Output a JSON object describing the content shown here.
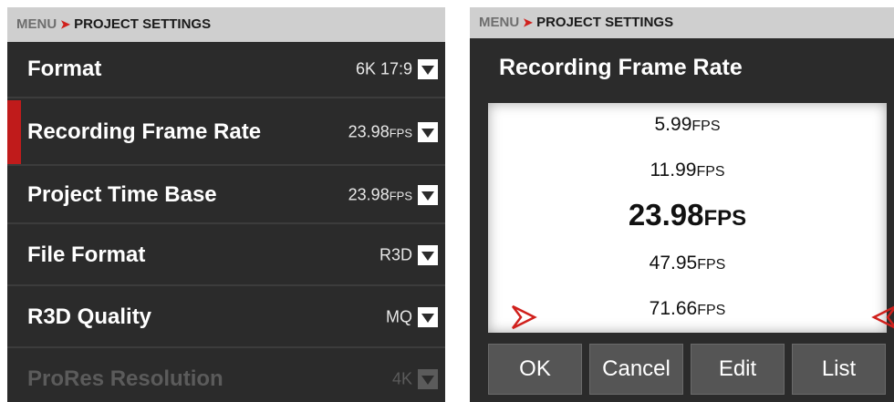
{
  "left": {
    "breadcrumb": {
      "root": "MENU",
      "arrow": "➤",
      "current": "PROJECT SETTINGS"
    },
    "rows": [
      {
        "label": "Format",
        "value": "6K 17:9",
        "unit": ""
      },
      {
        "label": "Recording Frame Rate",
        "value": "23.98",
        "unit": "FPS"
      },
      {
        "label": "Project Time Base",
        "value": "23.98",
        "unit": "FPS"
      },
      {
        "label": "File Format",
        "value": "R3D",
        "unit": ""
      },
      {
        "label": "R3D Quality",
        "value": "MQ",
        "unit": ""
      },
      {
        "label": "ProRes Resolution",
        "value": "4K",
        "unit": ""
      }
    ],
    "selected_row": "Recording Frame Rate",
    "disabled_row": "ProRes Resolution"
  },
  "right": {
    "breadcrumb": {
      "root": "MENU",
      "arrow": "➤",
      "current": "PROJECT SETTINGS"
    },
    "title": "Recording Frame Rate",
    "options": [
      {
        "value": "5.99",
        "unit": "FPS"
      },
      {
        "value": "11.99",
        "unit": "FPS"
      },
      {
        "value": "23.98",
        "unit": "FPS"
      },
      {
        "value": "47.95",
        "unit": "FPS"
      },
      {
        "value": "71.66",
        "unit": "FPS"
      }
    ],
    "selected_option": "23.98",
    "buttons": {
      "ok": "OK",
      "cancel": "Cancel",
      "edit": "Edit",
      "list": "List"
    }
  },
  "colors": {
    "accent": "#c01b1b",
    "panel": "#2b2b2b",
    "header": "#cfcfcf",
    "button": "#555555"
  },
  "icons": {
    "dropdown": "chevron-down-icon",
    "selector_left": "selector-arrow-right-icon",
    "selector_right": "selector-arrow-left-icon"
  }
}
